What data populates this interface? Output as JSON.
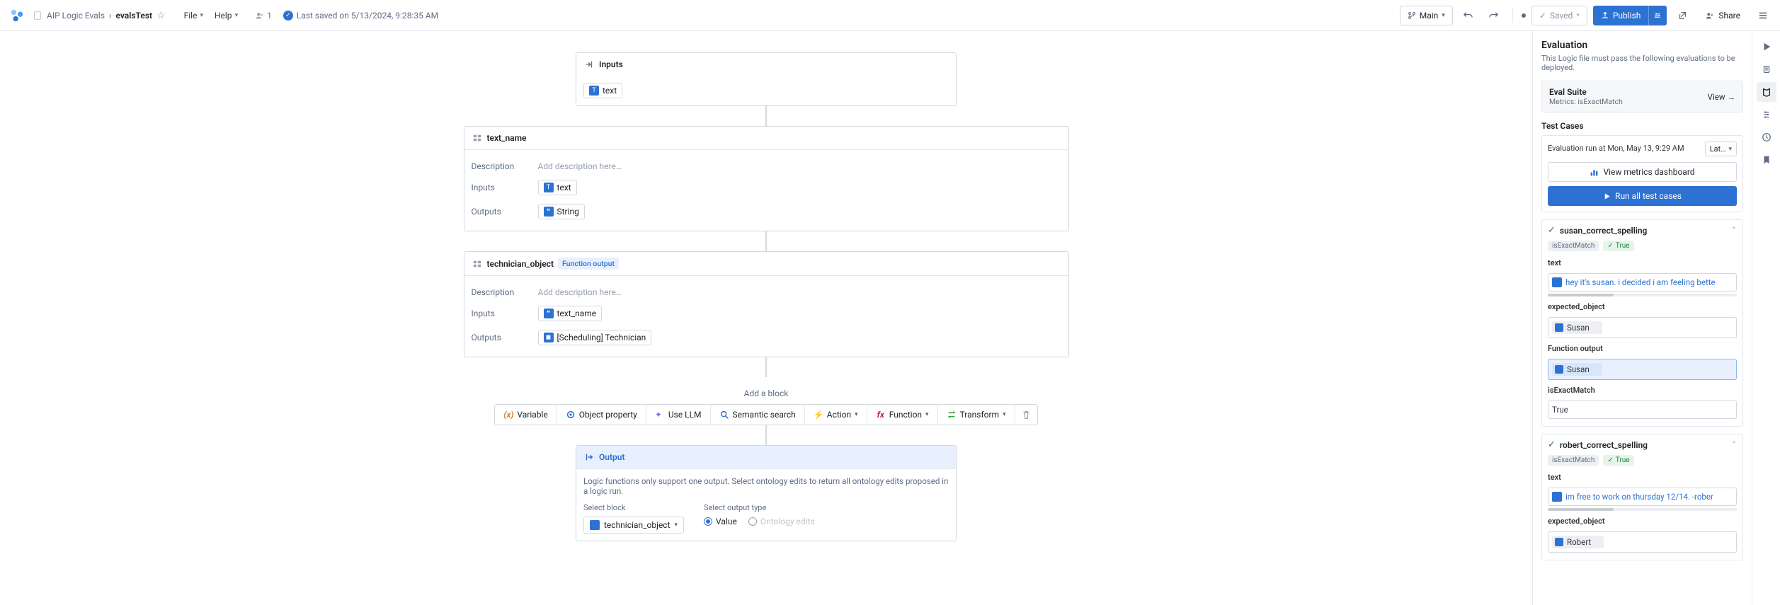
{
  "header": {
    "breadcrumb_parent": "AIP Logic Evals",
    "breadcrumb_current": "evalsTest",
    "menu_file": "File",
    "menu_help": "Help",
    "user_count": "1",
    "last_saved": "Last saved on 5/13/2024, 9:28:35 AM",
    "branch": "Main",
    "saved_label": "Saved",
    "publish_label": "Publish",
    "share_label": "Share"
  },
  "canvas": {
    "inputs_card": {
      "title": "Inputs",
      "chip_text": "text"
    },
    "node1": {
      "title": "text_name",
      "desc_label": "Description",
      "desc_placeholder": "Add description here…",
      "inputs_label": "Inputs",
      "input_chip": "text",
      "outputs_label": "Outputs",
      "output_chip": "String"
    },
    "node2": {
      "title": "technician_object",
      "func_out_tag": "Function output",
      "desc_label": "Description",
      "desc_placeholder": "Add description here…",
      "inputs_label": "Inputs",
      "input_chip": "text_name",
      "outputs_label": "Outputs",
      "output_chip": "[Scheduling] Technician"
    },
    "addblock_label": "Add a block",
    "tools": {
      "variable": "Variable",
      "object_property": "Object property",
      "use_llm": "Use LLM",
      "semantic_search": "Semantic search",
      "action": "Action",
      "function": "Function",
      "transform": "Transform"
    },
    "output_card": {
      "title": "Output",
      "desc": "Logic functions only support one output. Select ontology edits to return all ontology edits proposed in a logic run.",
      "select_block_label": "Select block",
      "select_block_value": "technician_object",
      "select_type_label": "Select output type",
      "radio_value": "Value",
      "radio_ontology": "Ontology edits"
    }
  },
  "panel": {
    "title": "Evaluation",
    "subtitle": "This Logic file must pass the following evaluations to be deployed.",
    "suite_title": "Eval Suite",
    "suite_metrics": "Metrics: isExactMatch",
    "view_label": "View",
    "testcases_heading": "Test Cases",
    "run_at": "Evaluation run at Mon, May 13, 9:29 AM",
    "latest_sel": "Lat…",
    "view_metrics_btn": "View metrics dashboard",
    "run_all_btn": "Run all test cases",
    "tc1": {
      "name": "susan_correct_spelling",
      "badge_metric": "isExactMatch",
      "badge_result": "True",
      "text_label": "text",
      "text_value": "hey it's susan. i decided i am feeling bette",
      "expected_label": "expected_object",
      "expected_value": "Susan",
      "funcout_label": "Function output",
      "funcout_value": "Susan",
      "isexact_label": "isExactMatch",
      "isexact_value": "True"
    },
    "tc2": {
      "name": "robert_correct_spelling",
      "badge_metric": "isExactMatch",
      "badge_result": "True",
      "text_label": "text",
      "text_value": "im free to work on thursday 12/14. -rober",
      "expected_label": "expected_object",
      "expected_value": "Robert"
    }
  }
}
